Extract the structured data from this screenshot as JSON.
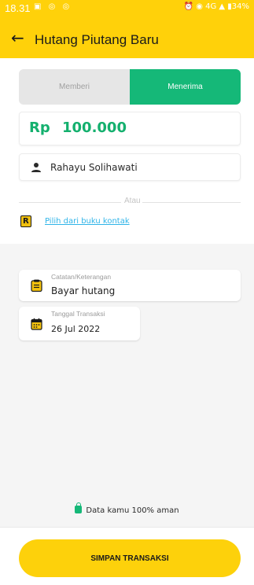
{
  "status_bar": {
    "time": "18.31",
    "left_icons": "▣ ◎ ◎",
    "right_icons": "⏰ ◉ 4G ▲ ▮34%"
  },
  "header": {
    "title": "Hutang Piutang Baru",
    "back_icon": "arrow-left-icon"
  },
  "type_toggle": {
    "options": [
      "Memberi",
      "Menerima"
    ],
    "selected": "Menerima"
  },
  "amount": {
    "currency": "Rp",
    "value": "100.000"
  },
  "contact": {
    "name": "Rahayu Solihawati",
    "separator": "Atau",
    "pick_link": "Pilih dari buku kontak"
  },
  "note": {
    "label": "Catatan/Keterangan",
    "value": "Bayar hutang"
  },
  "date": {
    "label": "Tanggal Transaksi",
    "value": "26 Jul 2022"
  },
  "security": {
    "text": "Data kamu 100% aman"
  },
  "actions": {
    "save_label": "SIMPAN TRANSAKSI"
  },
  "colors": {
    "brand_yellow": "#ffd10a",
    "accent_green": "#15b878",
    "link_blue": "#2fb4e8"
  }
}
